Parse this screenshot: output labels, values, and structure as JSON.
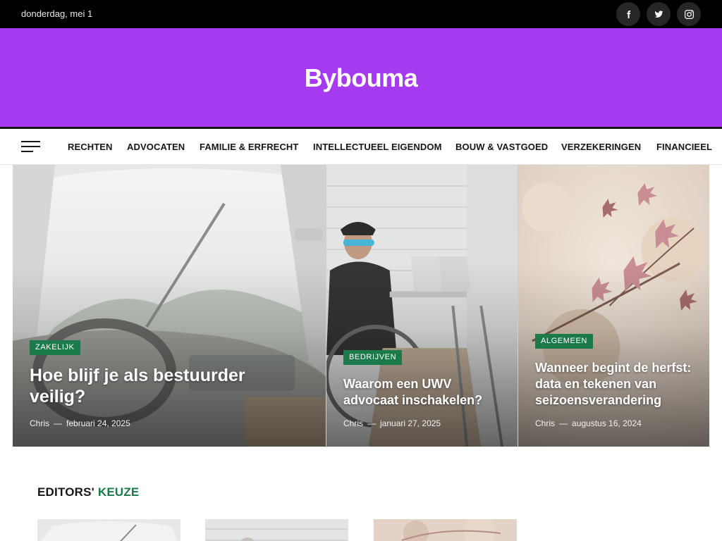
{
  "topbar": {
    "date": "donderdag, mei 1",
    "social": [
      {
        "icon": "facebook-icon",
        "label": "Facebook"
      },
      {
        "icon": "twitter-icon",
        "label": "Twitter"
      },
      {
        "icon": "instagram-icon",
        "label": "Instagram"
      }
    ]
  },
  "site": {
    "title": "Bybouma",
    "brand_color": "#a53af0",
    "accent_color": "#1a7a4a"
  },
  "nav": {
    "menu_icon": "hamburger-menu-icon",
    "items": [
      "RECHTEN",
      "ADVOCATEN",
      "FAMILIE & ERFRECHT",
      "INTELLECTUEEL EIGENDOM",
      "BOUW & VASTGOED",
      "VERZEKERINGEN",
      "FINANCIEEL"
    ]
  },
  "featured": [
    {
      "category": "ZAKELIJK",
      "title": "Hoe blijf je als bestuurder veilig?",
      "author": "Chris",
      "separator": "—",
      "date": "februari 24, 2025"
    },
    {
      "category": "BEDRIJVEN",
      "title": "Waarom een UWV advocaat inschakelen?",
      "author": "Chris",
      "separator": "—",
      "date": "januari 27, 2025"
    },
    {
      "category": "ALGEMEEN",
      "title": "Wanneer begint de herfst: data en tekenen van seizoensverandering",
      "author": "Chris",
      "separator": "—",
      "date": "augustus 16, 2024"
    }
  ],
  "editors": {
    "title_prefix": "EDITORS'",
    "title_accent": "KEUZE"
  }
}
